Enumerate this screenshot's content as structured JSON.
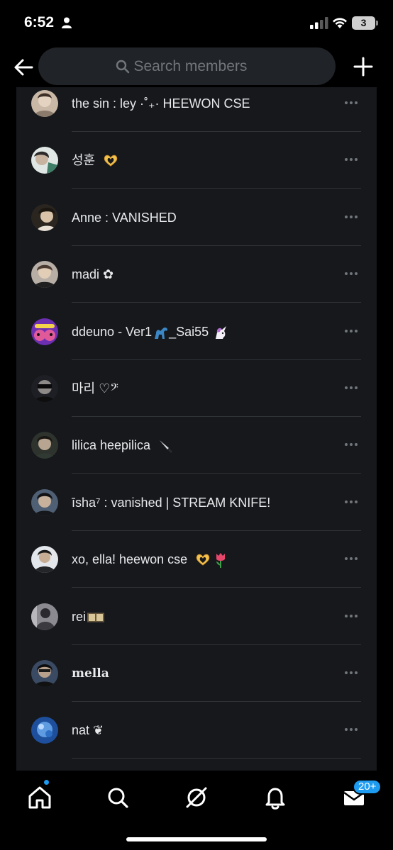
{
  "status_bar": {
    "time": "6:52",
    "battery_level": "3",
    "icons": [
      "person-icon",
      "signal-icon",
      "wifi-icon",
      "battery-icon"
    ]
  },
  "header": {
    "back_icon": "arrow-left-icon",
    "search_placeholder": "Search members",
    "search_value": "",
    "add_icon": "plus-icon"
  },
  "members": [
    {
      "name": "the sin : ley ·˚₊· HEEWON CSE",
      "avatar_color": "#b9a99a"
    },
    {
      "name": "성훈",
      "emoji": "heart-hands",
      "avatar_color": "#7a9a86"
    },
    {
      "name": "Anne : VANISHED",
      "avatar_color": "#8c7a64"
    },
    {
      "name": "madi ✿",
      "avatar_color": "#a3968c"
    },
    {
      "name": "ddeuno - Ver1",
      "extra": "_Sai55",
      "emoji": "dinosaur-unicorn",
      "avatar_color": "#7a3fb8"
    },
    {
      "name": "마리 ♡𝄢",
      "avatar_color": "#3b3f46"
    },
    {
      "name": "lilica heepilica",
      "emoji": "knife",
      "avatar_color": "#4b5048"
    },
    {
      "name": "īsha⁷ : vanished | STREAM KNIFE!",
      "avatar_color": "#39404a"
    },
    {
      "name": "xo, ella! heewon cse",
      "emoji": "heart-hands-tulip",
      "avatar_color": "#4a5363"
    },
    {
      "name": "rei",
      "emoji": "film",
      "avatar_color": "#6e6e74"
    },
    {
      "name": "mella",
      "avatar_color": "#3c4656"
    },
    {
      "name": "nat ❦",
      "avatar_color": "#2f6dbf"
    }
  ],
  "bottom_nav": {
    "items": [
      "home-icon",
      "search-icon",
      "grok-icon",
      "bell-icon",
      "mail-icon"
    ],
    "messages_badge": "20+",
    "accent": "#1d9bf0"
  }
}
